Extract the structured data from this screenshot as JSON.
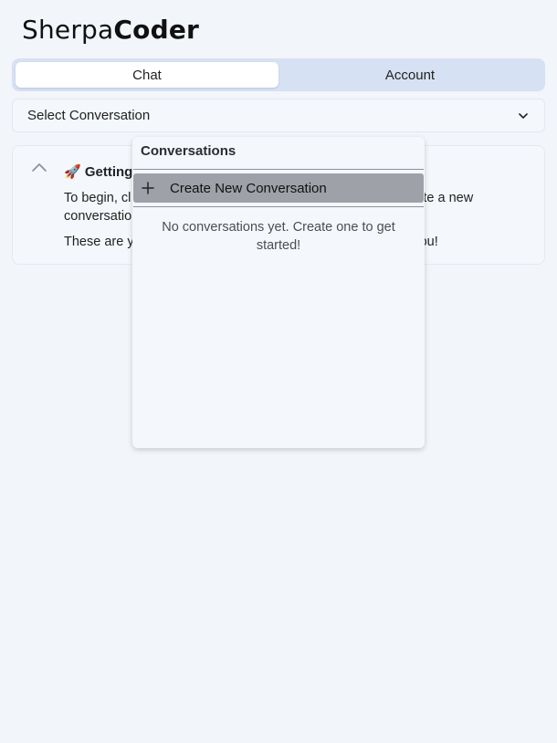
{
  "logo": {
    "light": "Sherpa",
    "bold": "Coder"
  },
  "tabs": [
    {
      "label": "Chat",
      "active": true
    },
    {
      "label": "Account",
      "active": false
    }
  ],
  "select": {
    "label": "Select Conversation",
    "icon": "chevron-down-icon"
  },
  "card": {
    "title": "🚀 Getting",
    "p1_a": "To begin, cl",
    "p1_b": "te a new",
    "p1_c": "conversatio",
    "p2_a": "These are y",
    "p2_b": "ou!"
  },
  "dropdown": {
    "header": "Conversations",
    "create_label": "Create New Conversation",
    "empty_text": "No conversations yet. Create one to get started!"
  },
  "colors": {
    "background": "#f2f5fa",
    "tabs_bg": "#d6e1f3",
    "create_highlight": "#9ea2a8"
  }
}
